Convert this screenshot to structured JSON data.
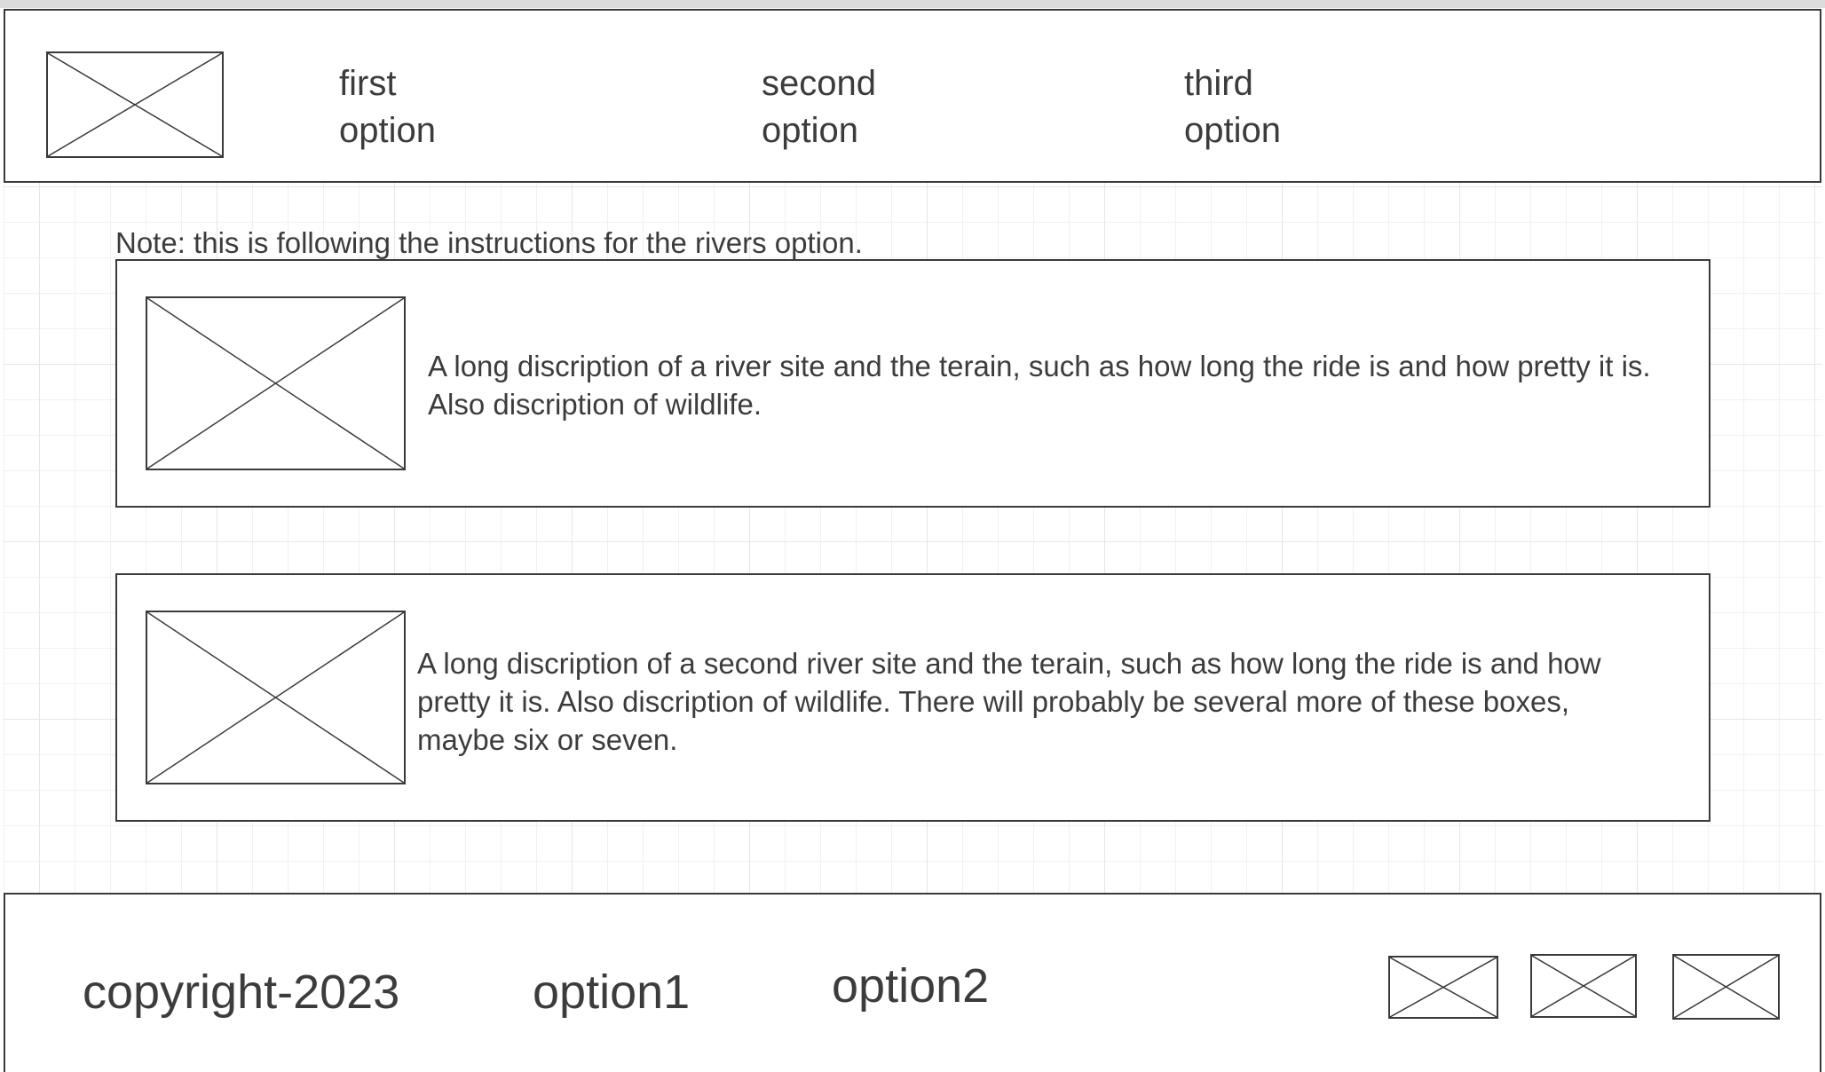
{
  "header": {
    "logo_icon": "image-placeholder-icon",
    "nav": [
      {
        "label": "first\noption"
      },
      {
        "label": "second\noption"
      },
      {
        "label": "third\noption"
      }
    ]
  },
  "main": {
    "note": "Note: this is following the instructions for the rivers option.",
    "cards": [
      {
        "image_icon": "image-placeholder-icon",
        "description": "A long discription of a river site and the terain, such as how long the ride is and how pretty it is. Also discription of wildlife."
      },
      {
        "image_icon": "image-placeholder-icon",
        "description": "A long discription of a second river site and the terain, such as how long the ride is and how pretty it is. Also discription of wildlife. There will probably be several more of these boxes, maybe six or seven."
      }
    ]
  },
  "footer": {
    "copyright": "copyright-2023",
    "option1": "option1",
    "option2": "option2",
    "social_icons": [
      "image-placeholder-icon",
      "image-placeholder-icon",
      "image-placeholder-icon"
    ]
  }
}
